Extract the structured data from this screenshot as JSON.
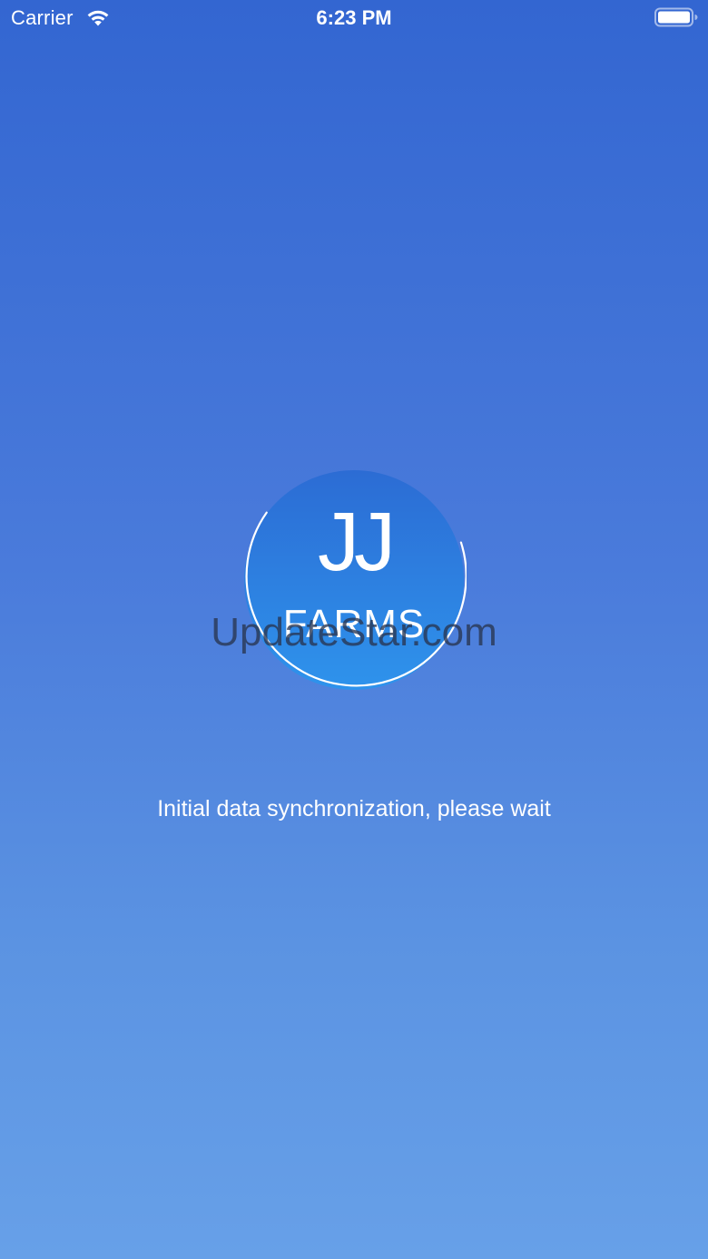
{
  "status_bar": {
    "carrier": "Carrier",
    "time": "6:23 PM",
    "wifi_icon": "wifi-icon",
    "battery_icon": "battery-full-icon"
  },
  "logo": {
    "line1": "JJ",
    "line2": "FARMS",
    "spinner_icon": "loading-ring-icon"
  },
  "watermark": "UpdateStar.com",
  "message": "Initial data synchronization, please wait",
  "colors": {
    "background_top": "#3366d1",
    "background_bottom": "#67a0e8",
    "logo_top": "#2c6cd4",
    "logo_bottom": "#2e93ec",
    "text": "#ffffff"
  }
}
